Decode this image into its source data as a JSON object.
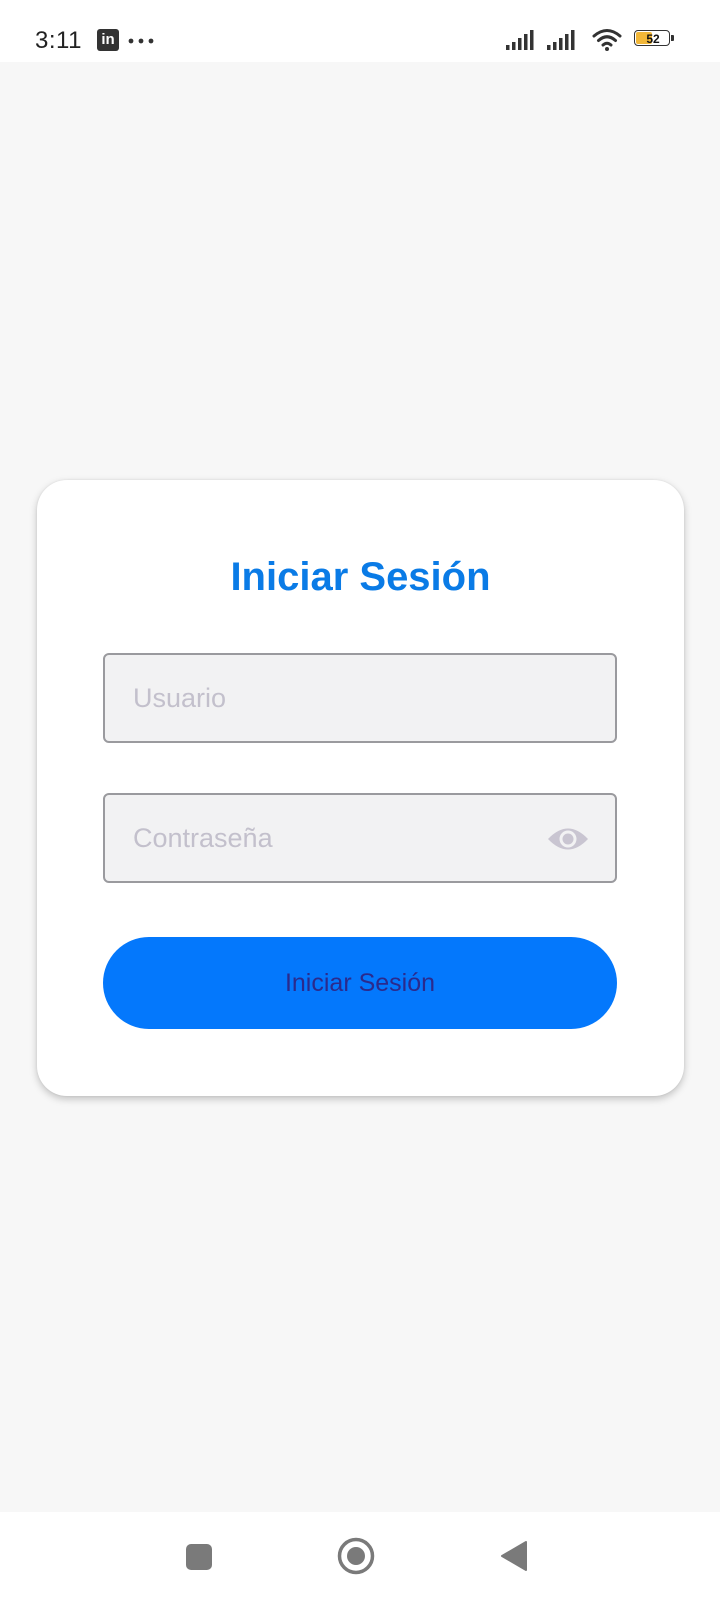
{
  "status_bar": {
    "time": "3:11",
    "notification_icons": [
      "linkedin-icon",
      "more-dots-icon"
    ],
    "system_icons": [
      "signal-icon",
      "signal-icon",
      "wifi-icon",
      "battery-icon"
    ],
    "battery_level": "52",
    "battery_fraction": 0.52,
    "battery_fill_color": "#f2b738"
  },
  "login": {
    "title": "Iniciar Sesión",
    "username_placeholder": "Usuario",
    "username_value": "",
    "password_placeholder": "Contraseña",
    "password_value": "",
    "password_toggle_icon": "eye-icon",
    "submit_label": "Iniciar Sesión"
  },
  "colors": {
    "accent": "#0a7be6",
    "button": "#0478fc",
    "button_text": "#2b2a8c",
    "background": "#f7f7f7",
    "field_background": "#f2f2f3"
  },
  "nav_bar": {
    "buttons": [
      "recents-square-icon",
      "home-circle-icon",
      "back-triangle-icon"
    ]
  }
}
